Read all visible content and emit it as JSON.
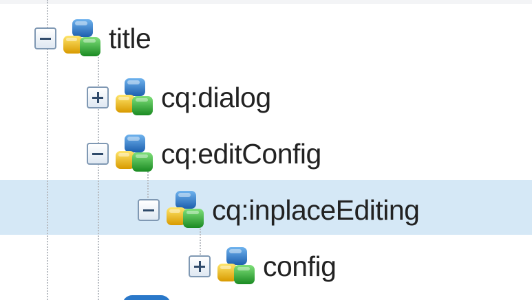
{
  "tree": {
    "nodes": [
      {
        "label": "title",
        "toggle": "minus",
        "icon": "component-cubes-icon",
        "selected": false
      },
      {
        "label": "cq:dialog",
        "toggle": "plus",
        "icon": "component-cubes-icon",
        "selected": false
      },
      {
        "label": "cq:editConfig",
        "toggle": "minus",
        "icon": "component-cubes-icon",
        "selected": false
      },
      {
        "label": "cq:inplaceEditing",
        "toggle": "minus",
        "icon": "component-cubes-icon",
        "selected": true
      },
      {
        "label": "config",
        "toggle": "plus",
        "icon": "component-cubes-icon",
        "selected": false
      }
    ]
  },
  "colors": {
    "selection": "#d5e8f6",
    "cube_blue": "#2a78c9",
    "cube_yellow": "#f2c21b",
    "cube_green": "#2fa52f"
  }
}
